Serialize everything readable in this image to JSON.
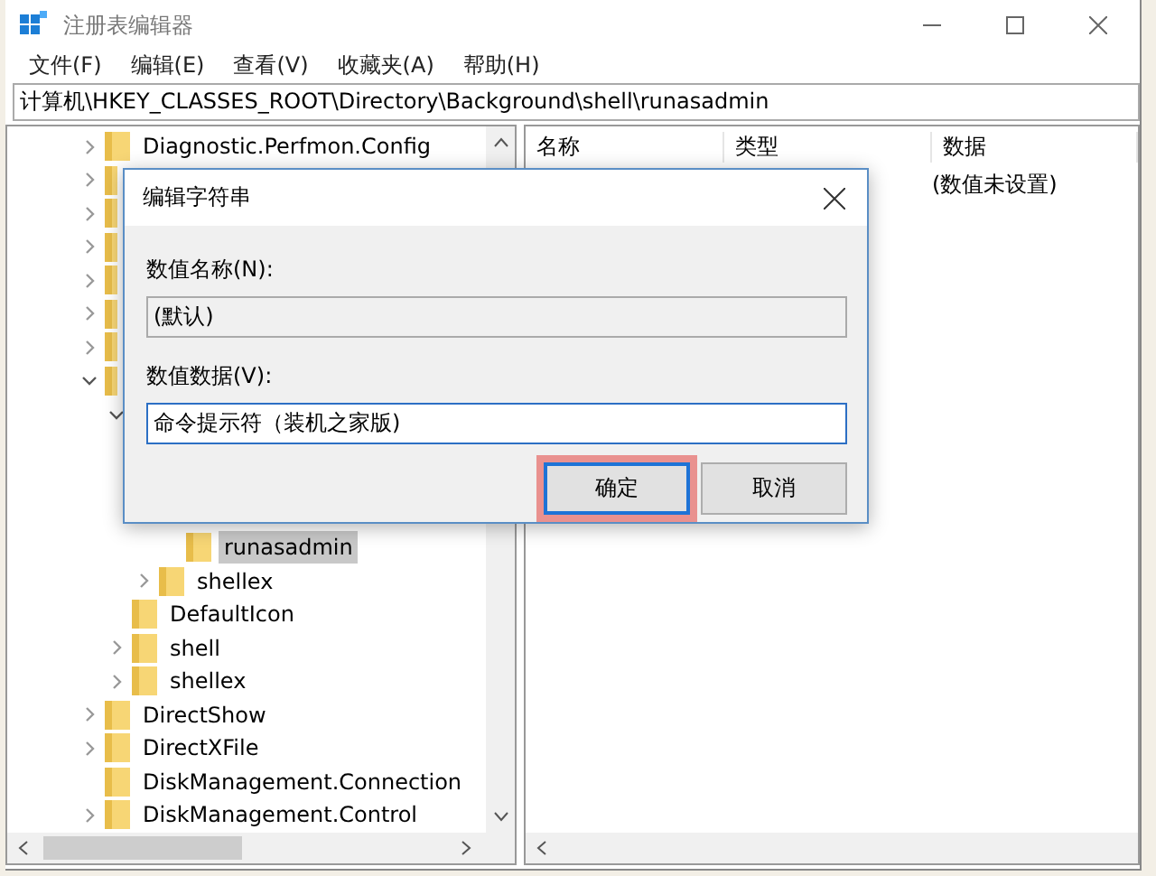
{
  "window": {
    "title": "注册表编辑器"
  },
  "menu": [
    {
      "label": "文件(F)"
    },
    {
      "label": "编辑(E)"
    },
    {
      "label": "查看(V)"
    },
    {
      "label": "收藏夹(A)"
    },
    {
      "label": "帮助(H)"
    }
  ],
  "address": "计算机\\HKEY_CLASSES_ROOT\\Directory\\Background\\shell\\runasadmin",
  "tree": [
    {
      "label": "Diagnostic.Perfmon.Config",
      "expanded": false,
      "selected": false
    },
    {
      "expanded": false
    },
    {
      "expanded": false
    },
    {
      "expanded": false
    },
    {
      "expanded": false
    },
    {
      "expanded": false
    },
    {
      "expanded": false
    },
    {
      "expanded": true,
      "children": [
        {
          "expanded": true,
          "children": [
            {
              "expanded": true,
              "children": [
                {
                  "kind": "covered"
                },
                {
                  "kind": "covered"
                },
                {
                  "label": "runasadmin",
                  "selected": true
                }
              ]
            },
            {
              "label": "shellex",
              "expanded": false,
              "selected": false
            }
          ]
        },
        {
          "label": "DefaultIcon",
          "selected": false
        },
        {
          "label": "shell",
          "expanded": false,
          "selected": false
        },
        {
          "label": "shellex",
          "expanded": false,
          "selected": false
        }
      ]
    },
    {
      "label": "DirectShow",
      "expanded": false,
      "selected": false
    },
    {
      "label": "DirectXFile",
      "expanded": false,
      "selected": false
    },
    {
      "label": "DiskManagement.Connection",
      "selected": false
    },
    {
      "label": "DiskManagement.Control",
      "expanded": false,
      "selected": false
    }
  ],
  "list": {
    "columns": [
      "名称",
      "类型",
      "数据"
    ],
    "rows": [
      {
        "data": "(数值未设置)"
      }
    ]
  },
  "dialog": {
    "title": "编辑字符串",
    "name_label": "数值名称(N):",
    "name_value": "(默认)",
    "data_label": "数值数据(V):",
    "data_value": "命令提示符（装机之家版)",
    "buttons": [
      {
        "label": "确定",
        "focused": true
      },
      {
        "label": "取消",
        "focused": false
      }
    ]
  }
}
